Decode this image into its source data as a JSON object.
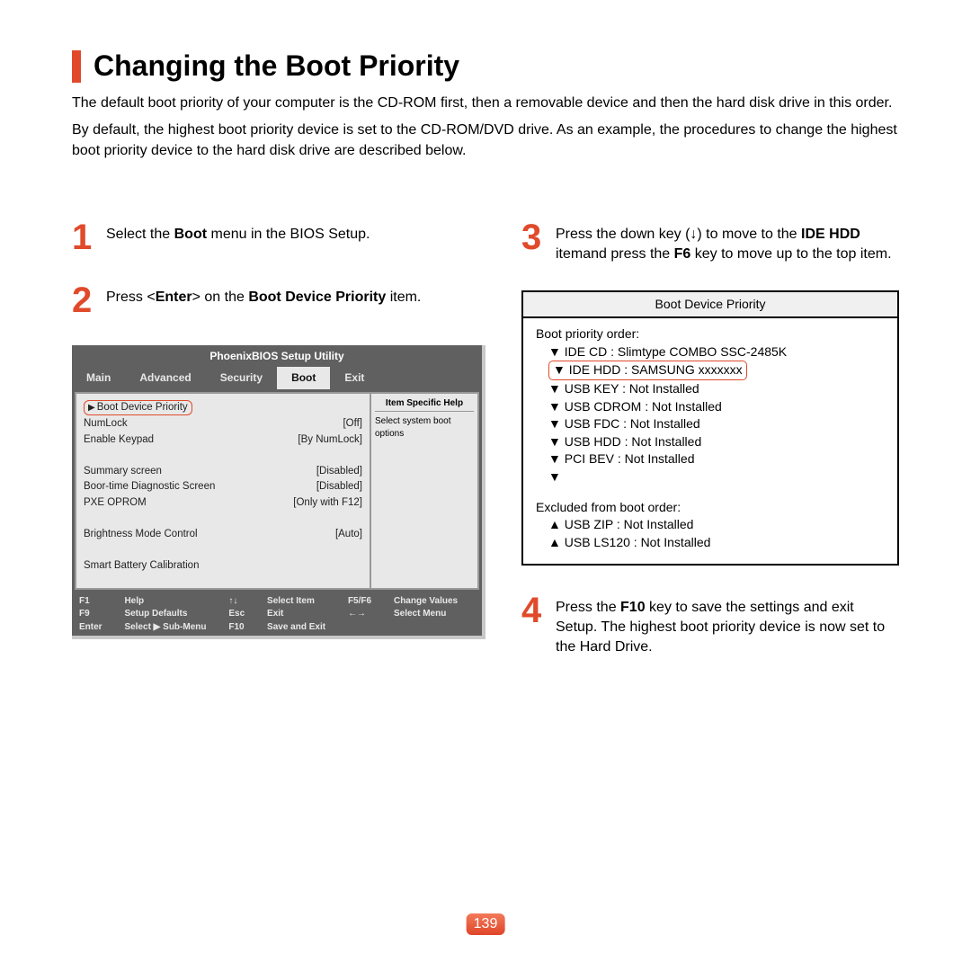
{
  "title": "Changing the Boot Priority",
  "intro1": "The default boot priority of your computer is the CD-ROM first, then a removable device and then the hard disk drive in this order.",
  "intro2": "By default, the highest boot priority device is set to the CD-ROM/DVD drive. As an example, the procedures to change the highest boot priority device to the hard disk drive are described below.",
  "steps": {
    "s1_num": "1",
    "s1_a": "Select the ",
    "s1_b": "Boot",
    "s1_c": " menu in the BIOS Setup.",
    "s2_num": "2",
    "s2_a": "Press <",
    "s2_b": "Enter",
    "s2_c": "> on the ",
    "s2_d": "Boot Device Priority",
    "s2_e": " item.",
    "s3_num": "3",
    "s3_a": "Press the down key (↓) to move to the ",
    "s3_b": "IDE HDD",
    "s3_c": " itemand press the ",
    "s3_d": "F6",
    "s3_e": " key to move up to the top item.",
    "s4_num": "4",
    "s4_a": "Press the ",
    "s4_b": "F10",
    "s4_c": " key to save the settings and exit Setup. The highest boot priority device is now set to the Hard Drive."
  },
  "bios": {
    "title": "PhoenixBIOS Setup Utility",
    "tabs": [
      "Main",
      "Advanced",
      "Security",
      "Boot",
      "Exit"
    ],
    "rows": [
      {
        "l": "Boot Device Priority",
        "r": ""
      },
      {
        "l": "NumLock",
        "r": "[Off]"
      },
      {
        "l": "Enable Keypad",
        "r": "[By NumLock]"
      },
      {
        "l": "",
        "r": ""
      },
      {
        "l": "Summary screen",
        "r": "[Disabled]"
      },
      {
        "l": "Boor-time Diagnostic Screen",
        "r": "[Disabled]"
      },
      {
        "l": "PXE OPROM",
        "r": "[Only with F12]"
      },
      {
        "l": "",
        "r": ""
      },
      {
        "l": "Brightness Mode Control",
        "r": "[Auto]"
      },
      {
        "l": "",
        "r": ""
      },
      {
        "l": "Smart Battery Calibration",
        "r": ""
      }
    ],
    "help_title": "Item Specific Help",
    "help_text": "Select system boot options",
    "footer": {
      "f1": "F1",
      "f1t": "Help",
      "ud": "↑↓",
      "udt": "Select Item",
      "f56": "F5/F6",
      "f56t": "Change Values",
      "f9": "F9",
      "f9t": "Setup Defaults",
      "esc": "Esc",
      "esct": "Exit",
      "lr": "←→",
      "lrt": "Select Menu",
      "ent": "Enter",
      "entt": "Select ▶ Sub-Menu",
      "f10": "F10",
      "f10t": "Save and Exit"
    }
  },
  "priority": {
    "title": "Boot Device Priority",
    "order_label": "Boot priority order:",
    "items": [
      "▼ IDE CD : Slimtype COMBO SSC-2485K",
      "▼ IDE HDD : SAMSUNG xxxxxxx",
      "▼ USB KEY : Not Installed",
      "▼ USB CDROM : Not Installed",
      "▼ USB FDC : Not Installed",
      "▼ USB HDD : Not Installed",
      "▼ PCI BEV : Not Installed",
      "▼"
    ],
    "excluded_label": "Excluded from boot order:",
    "excluded": [
      "▲ USB ZIP : Not Installed",
      "▲ USB LS120 : Not Installed"
    ]
  },
  "page_num": "139"
}
